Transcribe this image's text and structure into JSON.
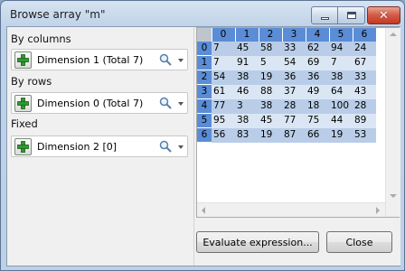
{
  "window": {
    "title": "Browse array \"m\""
  },
  "titlebar": {
    "close_glyph": "✕"
  },
  "left": {
    "sections": [
      {
        "label": "By columns",
        "combo_text": "Dimension 1 (Total 7)"
      },
      {
        "label": "By rows",
        "combo_text": "Dimension 0 (Total 7)"
      },
      {
        "label": "Fixed",
        "combo_text": "Dimension 2 [0]"
      }
    ]
  },
  "grid": {
    "col_headers": [
      "0",
      "1",
      "2",
      "3",
      "4",
      "5",
      "6"
    ],
    "row_headers": [
      "0",
      "1",
      "2",
      "3",
      "4",
      "5",
      "6"
    ],
    "rows": [
      [
        "7",
        "45",
        "58",
        "33",
        "62",
        "94",
        "24"
      ],
      [
        "7",
        "91",
        "5",
        "54",
        "69",
        "7",
        "67"
      ],
      [
        "54",
        "38",
        "19",
        "36",
        "36",
        "38",
        "33"
      ],
      [
        "61",
        "46",
        "88",
        "37",
        "49",
        "64",
        "43"
      ],
      [
        "77",
        "3",
        "38",
        "28",
        "18",
        "100",
        "28"
      ],
      [
        "95",
        "38",
        "45",
        "77",
        "75",
        "44",
        "89"
      ],
      [
        "56",
        "83",
        "19",
        "87",
        "66",
        "19",
        "53"
      ]
    ],
    "colors": {
      "header": "#5b8dd6",
      "row_even": "#b9cde8",
      "row_odd": "#dbe6f4"
    }
  },
  "buttons": {
    "evaluate": "Evaluate expression...",
    "close": "Close"
  },
  "icons": {
    "add": "plus-icon",
    "search": "search-icon",
    "dropdown": "chevron-down-icon"
  }
}
